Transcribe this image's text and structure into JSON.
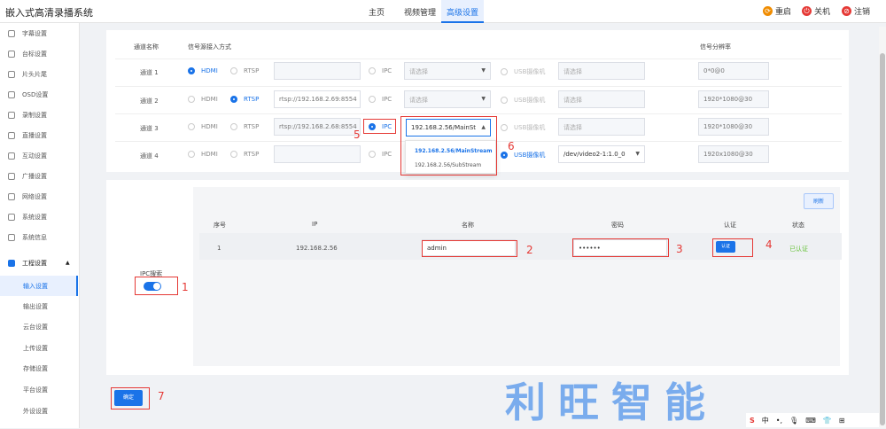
{
  "app": {
    "title": "嵌入式高清录播系统"
  },
  "nav": {
    "home": "主页",
    "video": "视频管理",
    "advanced": "高级设置"
  },
  "actions": {
    "restart": "重启",
    "shutdown": "关机",
    "logout": "注销"
  },
  "sidebar": {
    "items": [
      "字幕设置",
      "台标设置",
      "片头片尾",
      "OSD设置",
      "录制设置",
      "直播设置",
      "互动设置",
      "广播设置",
      "网络设置",
      "系统设置",
      "系统信息"
    ],
    "group": "工程设置",
    "subitems": [
      "输入设置",
      "输出设置",
      "云台设置",
      "上传设置",
      "存储设置",
      "平台设置",
      "外设设置"
    ]
  },
  "table": {
    "headers": {
      "channel": "通道名称",
      "source": "信号源接入方式",
      "resolution": "信号分辨率"
    },
    "rows": [
      {
        "name": "通道 1",
        "hdmi": "HDMI",
        "rtsp": "RTSP",
        "rtsp_url": "",
        "ipc": "IPC",
        "ipc_sel": "请选择",
        "usb": "USB摄像机",
        "usb_sel": "请选择",
        "res": "0*0@0"
      },
      {
        "name": "通道 2",
        "hdmi": "HDMI",
        "rtsp": "RTSP",
        "rtsp_url": "rtsp://192.168.2.69:8554",
        "ipc": "IPC",
        "ipc_sel": "请选择",
        "usb": "USB摄像机",
        "usb_sel": "请选择",
        "res": "1920*1080@30"
      },
      {
        "name": "通道 3",
        "hdmi": "HDMI",
        "rtsp": "RTSP",
        "rtsp_url": "rtsp://192.168.2.68:8554",
        "ipc": "IPC",
        "ipc_sel": "192.168.2.56/MainSt",
        "usb": "USB摄像机",
        "usb_sel": "请选择",
        "res": "1920*1080@30"
      },
      {
        "name": "通道 4",
        "hdmi": "HDMI",
        "rtsp": "RTSP",
        "rtsp_url": "",
        "ipc": "IPC",
        "ipc_sel": "",
        "usb": "USB摄像机",
        "usb_sel": "/dev/video2-1:1.0_0",
        "res": "1920x1080@30"
      }
    ]
  },
  "dropdown": {
    "options": [
      "192.168.2.56/MainStream",
      "192.168.2.56/SubStream"
    ]
  },
  "ipc": {
    "label": "IPC搜索",
    "refresh": "刷新",
    "headers": {
      "index": "序号",
      "ip": "IP",
      "name": "名称",
      "password": "密码",
      "auth": "认证",
      "status": "状态"
    },
    "row": {
      "index": "1",
      "ip": "192.168.2.56",
      "name": "admin",
      "password": "••••••",
      "auth": "认证",
      "status": "已认证"
    }
  },
  "confirm": "确定",
  "annotations": [
    "1",
    "2",
    "3",
    "4",
    "5",
    "6",
    "7"
  ],
  "watermark": "利旺智能",
  "ime": {
    "s": "S",
    "lang": "中",
    "dot": "•,"
  },
  "colors": {
    "accent": "#1a73e8",
    "highlight": "#e53935",
    "success": "#67c23a"
  }
}
